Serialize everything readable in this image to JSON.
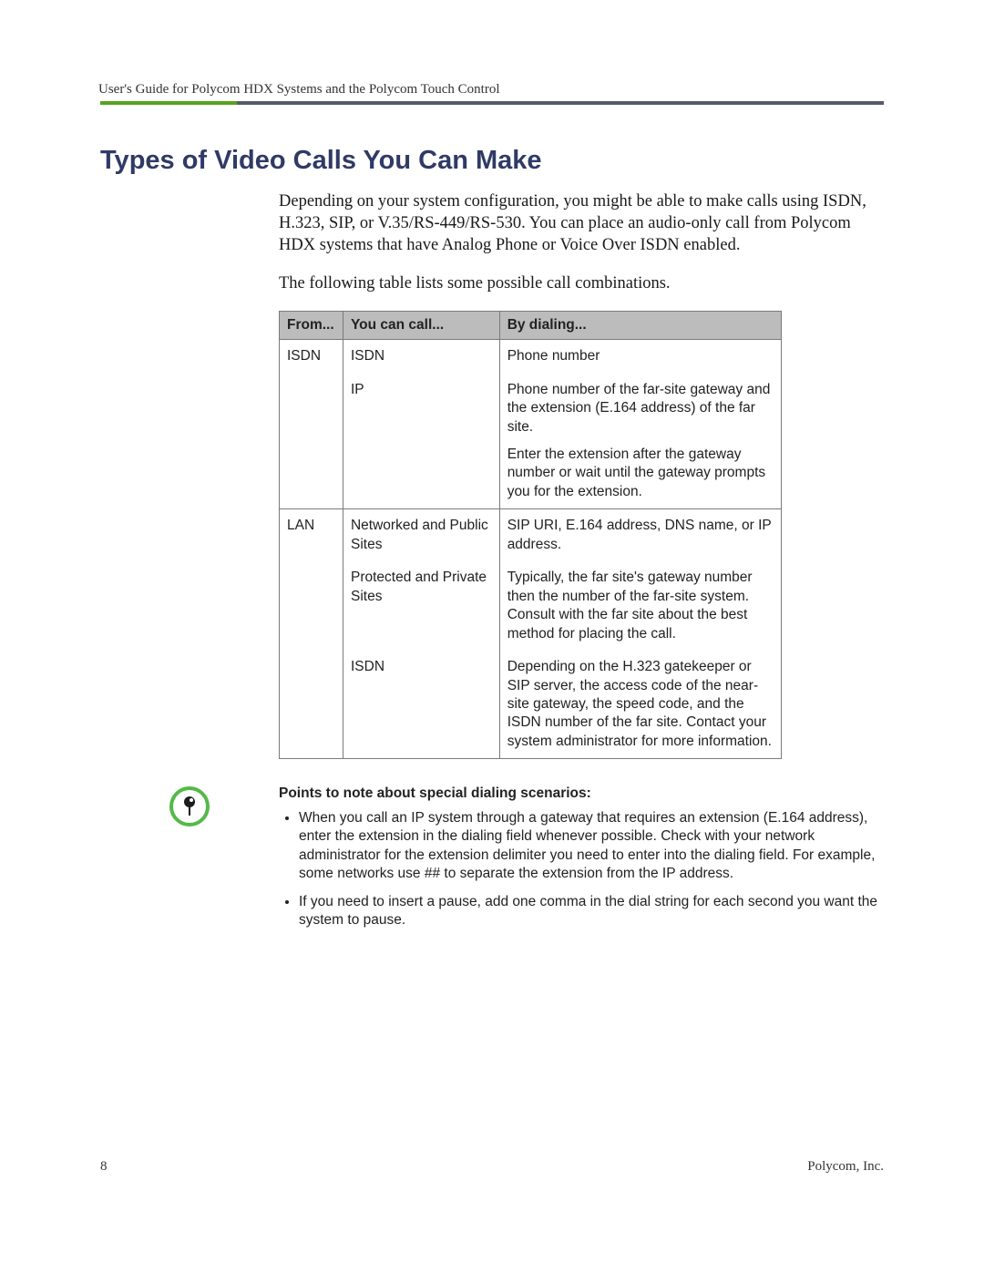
{
  "header": {
    "running_head": "User's Guide for Polycom HDX Systems and the Polycom Touch Control"
  },
  "section": {
    "title": "Types of Video Calls You Can Make",
    "intro_p1": "Depending on your system configuration, you might be able to make calls using ISDN, H.323, SIP, or V.35/RS-449/RS-530. You can place an audio-only call from Polycom HDX systems that have Analog Phone or Voice Over ISDN enabled.",
    "intro_p2": "The following table lists some possible call combinations."
  },
  "table": {
    "headers": {
      "from": "From...",
      "call": "You can call...",
      "dial": "By dialing..."
    },
    "groups": [
      {
        "from": "ISDN",
        "rows": [
          {
            "call": "ISDN",
            "dial": "Phone number"
          },
          {
            "call": "IP",
            "dial": "Phone number of the far-site gateway and the extension (E.164 address) of the far site.",
            "dial_extra": "Enter the extension after the gateway number or wait until the gateway prompts you for the extension."
          }
        ]
      },
      {
        "from": "LAN",
        "rows": [
          {
            "call": "Networked and Public Sites",
            "dial": "SIP URI, E.164 address, DNS name, or IP address."
          },
          {
            "call": "Protected and Private Sites",
            "dial": "Typically, the far site's gateway number then the number of the far-site system. Consult with the far site about the best method for placing the call."
          },
          {
            "call": "ISDN",
            "dial": "Depending on the H.323 gatekeeper or SIP server, the access code of the near-site gateway, the speed code, and the ISDN number of the far site. Contact your system administrator for more information."
          }
        ]
      }
    ]
  },
  "note": {
    "title": "Points to note about special dialing scenarios:",
    "items": [
      "When you call an IP system through a gateway that requires an extension (E.164 address), enter the extension in the dialing field whenever possible. Check with your network administrator for the extension delimiter you need to enter into the dialing field. For example, some networks use ## to separate the extension from the IP address.",
      "If you need to insert a pause, add one comma in the dial string for each second you want the system to pause."
    ]
  },
  "footer": {
    "page_number": "8",
    "company": "Polycom, Inc."
  }
}
